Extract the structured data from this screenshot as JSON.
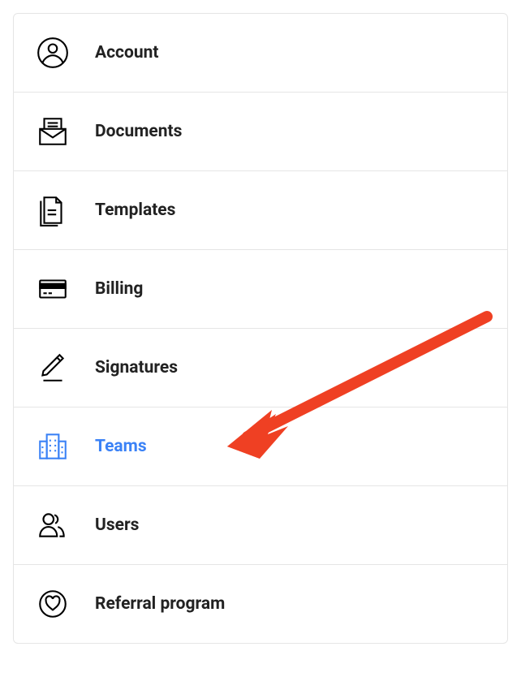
{
  "menu": {
    "items": [
      {
        "label": "Account",
        "active": false
      },
      {
        "label": "Documents",
        "active": false
      },
      {
        "label": "Templates",
        "active": false
      },
      {
        "label": "Billing",
        "active": false
      },
      {
        "label": "Signatures",
        "active": false
      },
      {
        "label": "Teams",
        "active": true
      },
      {
        "label": "Users",
        "active": false
      },
      {
        "label": "Referral program",
        "active": false
      }
    ]
  },
  "annotation": {
    "arrow_color": "#ef4023",
    "target_item": "Teams"
  }
}
